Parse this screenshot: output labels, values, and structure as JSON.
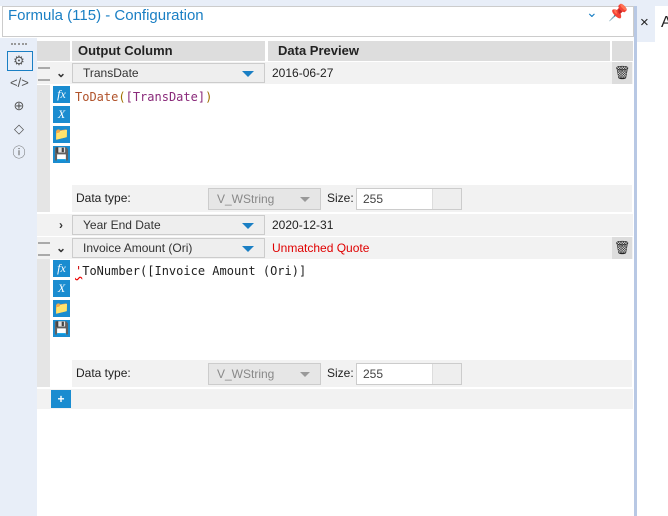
{
  "window": {
    "title": "Formula (115) - Configuration",
    "close": "×",
    "right_letter": "A"
  },
  "sidebar": {
    "icons": [
      "gear-icon",
      "code-icon",
      "navigate-icon",
      "tag-icon",
      "help-icon"
    ]
  },
  "columns": {
    "output": "Output Column",
    "preview": "Data Preview"
  },
  "rows": [
    {
      "name": "TransDate",
      "preview": "2016-06-27",
      "expanded": true,
      "formula_parts": [
        {
          "t": "ToDate",
          "c": "#b0522a"
        },
        {
          "t": "(",
          "c": "#a07000"
        },
        {
          "t": "[TransDate]",
          "c": "#8a2a7a"
        },
        {
          "t": ")",
          "c": "#a07000"
        }
      ],
      "data_type_label": "Data type:",
      "data_type": "V_WString",
      "size_label": "Size:",
      "size": "255"
    },
    {
      "name": "Year End Date",
      "preview": "2020-12-31",
      "expanded": false
    },
    {
      "name": "Invoice Amount (Ori)",
      "preview": "Unmatched Quote",
      "preview_color": "#e00000",
      "expanded": true,
      "formula_quote": "'",
      "formula": "ToNumber([Invoice Amount (Ori)]",
      "data_type_label": "Data type:",
      "data_type": "V_WString",
      "size_label": "Size:",
      "size": "255"
    }
  ],
  "formula_buttons": {
    "fx": "fx",
    "var": "X"
  },
  "add_button": "+"
}
